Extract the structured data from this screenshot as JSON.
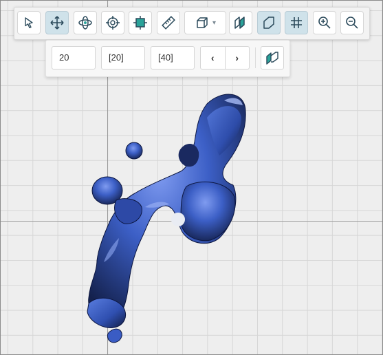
{
  "toolbar": {
    "buttons": [
      {
        "name": "select-tool-button",
        "icon": "pointer-icon",
        "active": false
      },
      {
        "name": "pan-tool-button",
        "icon": "move-arrows-icon",
        "active": true
      },
      {
        "name": "rotate-tool-button",
        "icon": "orbit-icon",
        "active": false
      },
      {
        "name": "center-tool-button",
        "icon": "crosshair-icon",
        "active": false
      },
      {
        "name": "fit-view-button",
        "icon": "fit-frame-icon",
        "active": false
      },
      {
        "name": "measure-tool-button",
        "icon": "ruler-icon",
        "active": false
      },
      {
        "name": "view-cube-dropdown",
        "icon": "cube-icon",
        "active": false
      },
      {
        "name": "slice-view-button",
        "icon": "slices-icon",
        "active": false
      },
      {
        "name": "plane-toggle-button",
        "icon": "plane-icon",
        "active": true
      },
      {
        "name": "grid-toggle-button",
        "icon": "grid-icon",
        "active": true
      },
      {
        "name": "zoom-in-button",
        "icon": "zoom-in-icon",
        "active": false
      },
      {
        "name": "zoom-out-button",
        "icon": "zoom-out-icon",
        "active": false
      }
    ]
  },
  "subbar": {
    "slice_value": "20",
    "slice_range_a": "[20]",
    "slice_range_b": "[40]",
    "prev_label": "‹",
    "next_label": "›"
  },
  "colors": {
    "accent_active": "#cfe2ea",
    "icon": "#2b4a5b",
    "teal": "#2aa39a",
    "mesh": "#4466cc"
  }
}
